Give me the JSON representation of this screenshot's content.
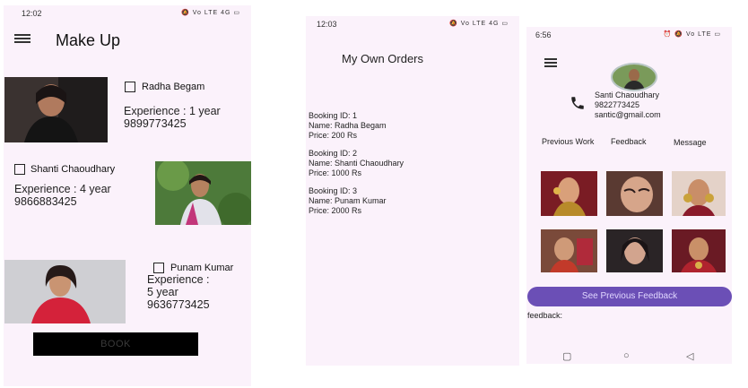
{
  "makeup": {
    "status_time": "12:02",
    "status_icons": "🔕 Vo LTE 4G ▭",
    "title": "Make Up",
    "artists": [
      {
        "name": "Radha Begam",
        "experience": "Experience : 1 year",
        "phone": "9899773425"
      },
      {
        "name": "Shanti Chaoudhary",
        "experience": "Experience : 4 year",
        "phone": "9866883425"
      },
      {
        "name": "Punam Kumar",
        "experience_label": "Experience :",
        "experience_value": "5 year",
        "phone": "9636773425"
      }
    ],
    "book_label": "BOOK"
  },
  "orders": {
    "status_time": "12:03",
    "status_icons": "🔕 Vo LTE 4G ▭",
    "title": "My Own Orders",
    "items": [
      {
        "id": "Booking ID: 1",
        "name": "Name: Radha Begam",
        "price": "Price: 200 Rs"
      },
      {
        "id": "Booking ID: 2",
        "name": "Name: Shanti Chaoudhary",
        "price": "Price: 1000 Rs"
      },
      {
        "id": "Booking ID: 3",
        "name": "Name: Punam Kumar",
        "price": "Price: 2000 Rs"
      }
    ]
  },
  "profile": {
    "status_time": "6:56",
    "status_icons": "⏰ 🔕 Vo LTE ▭",
    "name": "Santi Chaoudhary",
    "phone": "9822773425",
    "email": "santic@gmail.com",
    "tabs": [
      "Previous Work",
      "Feedback",
      "Message"
    ],
    "see_feedback_label": "See Previous Feedback",
    "feedback_label": "feedback:"
  },
  "nav_icons": {
    "square": "▢",
    "circle": "○",
    "back": "◁"
  }
}
